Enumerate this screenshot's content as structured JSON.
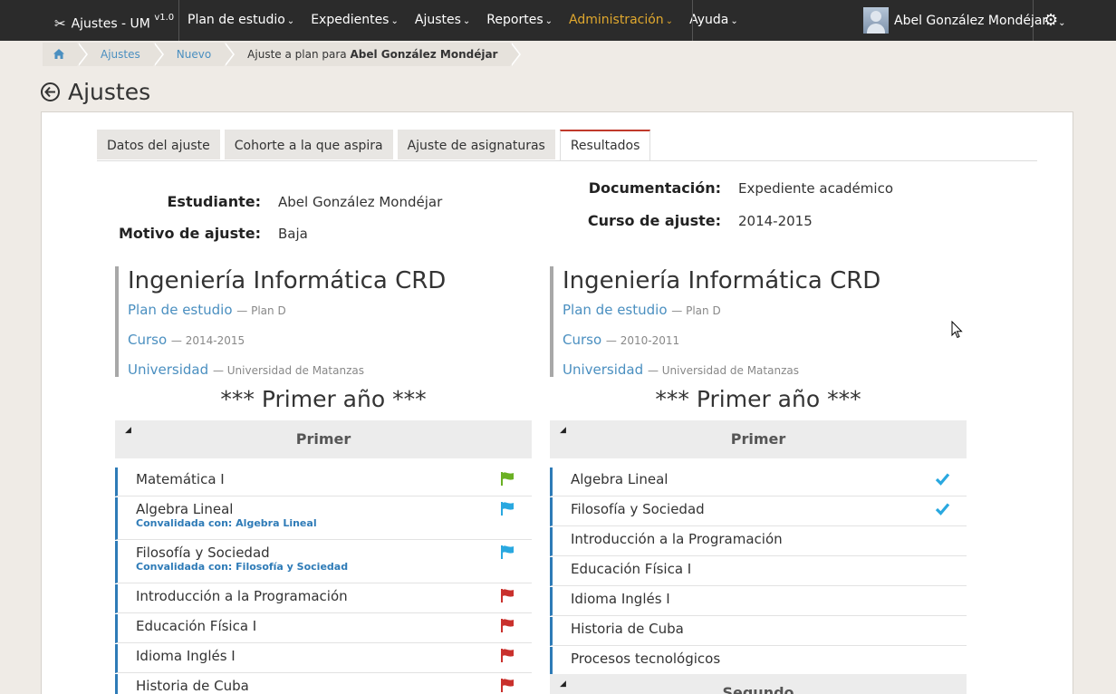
{
  "app": {
    "name": "Ajustes - UM",
    "version": "v1.0"
  },
  "nav": {
    "items": [
      {
        "label": "Plan de estudio",
        "caret": "⌄"
      },
      {
        "label": "Expedientes",
        "caret": "⌄"
      },
      {
        "label": "Ajustes",
        "caret": "⌄"
      },
      {
        "label": "Reportes",
        "caret": "⌄"
      },
      {
        "label": "Administración",
        "caret": "⌄"
      },
      {
        "label": "Ayuda",
        "caret": "⌄"
      }
    ],
    "user": "Abel González Mondéjar"
  },
  "breadcrumb": {
    "home_icon": "home-icon",
    "items": [
      "Ajustes",
      "Nuevo"
    ],
    "current_prefix": "Ajuste a plan para",
    "current_name": "Abel González Mondéjar"
  },
  "page": {
    "title": "Ajustes"
  },
  "tabs": [
    "Datos del ajuste",
    "Cohorte a la que aspira",
    "Ajuste de asignaturas",
    "Resultados"
  ],
  "info": {
    "student_label": "Estudiante:",
    "student_value": "Abel González Mondéjar",
    "reason_label": "Motivo de ajuste:",
    "reason_value": "Baja",
    "doc_label": "Documentación:",
    "doc_value": "Expediente académico",
    "course_label": "Curso de ajuste:",
    "course_value": "2014-2015"
  },
  "left": {
    "title": "Ingeniería Informática CRD",
    "plan_label": "Plan de estudio",
    "plan_value": "— Plan D",
    "course_label": "Curso",
    "course_value": "— 2014-2015",
    "uni_label": "Universidad",
    "uni_value": "— Universidad de Matanzas",
    "year_title": "*** Primer año ***",
    "semester": "Primer",
    "subjects": [
      {
        "name": "Matemática I",
        "conv": "",
        "flag_color": "#6ab023"
      },
      {
        "name": "Algebra Lineal",
        "conv": "Convalidada con: Algebra Lineal",
        "flag_color": "#29a8e0"
      },
      {
        "name": "Filosofía y Sociedad",
        "conv": "Convalidada con: Filosofía y Sociedad",
        "flag_color": "#29a8e0"
      },
      {
        "name": "Introducción a la Programación",
        "conv": "",
        "flag_color": "#c9302c"
      },
      {
        "name": "Educación Física I",
        "conv": "",
        "flag_color": "#c9302c"
      },
      {
        "name": "Idioma Inglés I",
        "conv": "",
        "flag_color": "#c9302c"
      },
      {
        "name": "Historia de Cuba",
        "conv": "",
        "flag_color": "#c9302c"
      }
    ]
  },
  "right": {
    "title": "Ingeniería Informática CRD",
    "plan_label": "Plan de estudio",
    "plan_value": "— Plan D",
    "course_label": "Curso",
    "course_value": "— 2010-2011",
    "uni_label": "Universidad",
    "uni_value": "— Universidad de Matanzas",
    "year_title": "*** Primer año ***",
    "semester": "Primer",
    "semester2": "Segundo",
    "subjects": [
      {
        "name": "Algebra Lineal",
        "check": true
      },
      {
        "name": "Filosofía y Sociedad",
        "check": true
      },
      {
        "name": "Introducción a la Programación",
        "check": false
      },
      {
        "name": "Educación Física I",
        "check": false
      },
      {
        "name": "Idioma Inglés I",
        "check": false
      },
      {
        "name": "Historia de Cuba",
        "check": false
      },
      {
        "name": "Procesos tecnológicos",
        "check": false
      }
    ]
  }
}
